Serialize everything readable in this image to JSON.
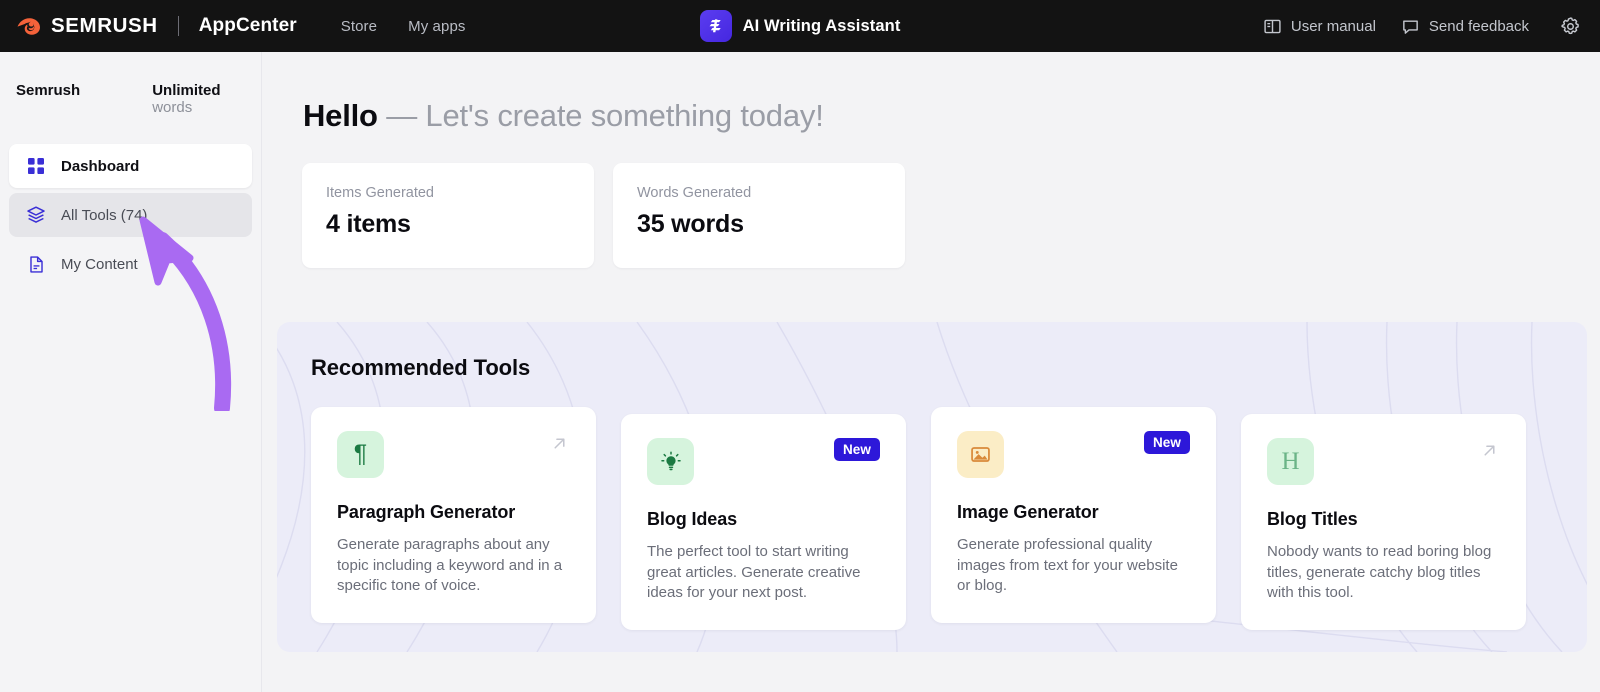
{
  "topbar": {
    "logo_icon": "semrush-comet-logo",
    "brand": "SEMRUSH",
    "product": "AppCenter",
    "nav": [
      {
        "label": "Store",
        "name": "store"
      },
      {
        "label": "My apps",
        "name": "my-apps"
      }
    ],
    "app": {
      "icon": "semrush-app-logo-icon",
      "title": "AI Writing Assistant"
    },
    "right": [
      {
        "label": "User manual",
        "icon": "book-icon",
        "name": "user-manual"
      },
      {
        "label": "Send feedback",
        "icon": "speech-bubble-icon",
        "name": "send-feedback"
      }
    ],
    "settings_icon": "gear-icon"
  },
  "sidebar": {
    "brand": "Semrush",
    "quota_value": "Unlimited",
    "quota_unit": " words",
    "items": [
      {
        "label": "Dashboard",
        "icon": "grid-icon",
        "state": "active"
      },
      {
        "label": "All Tools (74)",
        "icon": "layers-icon",
        "state": "hover"
      },
      {
        "label": "My Content",
        "icon": "document-icon",
        "state": "plain"
      }
    ]
  },
  "annotation": {
    "type": "curved-arrow",
    "color": "#a96af2",
    "points_to": "All Tools (74)"
  },
  "main": {
    "greeting_bold": "Hello",
    "greeting_rest": " — Let's create something today!",
    "stats": [
      {
        "label": "Items Generated",
        "value": "4 items"
      },
      {
        "label": "Words Generated",
        "value": "35 words"
      }
    ],
    "recommended": {
      "title": "Recommended Tools",
      "panel_color": "#ececf8",
      "cards": [
        {
          "title": "Paragraph Generator",
          "desc": "Generate paragraphs about any topic including a keyword and in a specific tone of voice.",
          "icon": "pilcrow-icon",
          "icon_glyph": "¶",
          "tile_color": "#d6f4dd",
          "corner": "arrow-up-right-icon",
          "badge": null
        },
        {
          "title": "Blog Ideas",
          "desc": "The perfect tool to start writing great articles. Generate creative ideas for your next post.",
          "icon": "lightbulb-icon",
          "icon_glyph": "",
          "tile_color": "#d6f4dd",
          "corner": "badge",
          "badge": "New"
        },
        {
          "title": "Image Generator",
          "desc": "Generate professional quality images from text for your website or blog.",
          "icon": "image-icon",
          "icon_glyph": "",
          "tile_color": "#fbedc6",
          "corner": "badge",
          "badge": "New"
        },
        {
          "title": "Blog Titles",
          "desc": "Nobody wants to read boring blog titles, generate catchy blog titles with this tool.",
          "icon": "heading-h-icon",
          "icon_glyph": "H",
          "tile_color": "#d6f4dd",
          "corner": "arrow-up-right-icon",
          "badge": null
        }
      ]
    }
  },
  "colors": {
    "accent_indigo": "#3a2fd6",
    "badge_blue": "#2d18d9",
    "semrush_orange": "#f4623a",
    "annotation_purple": "#a96af2"
  }
}
